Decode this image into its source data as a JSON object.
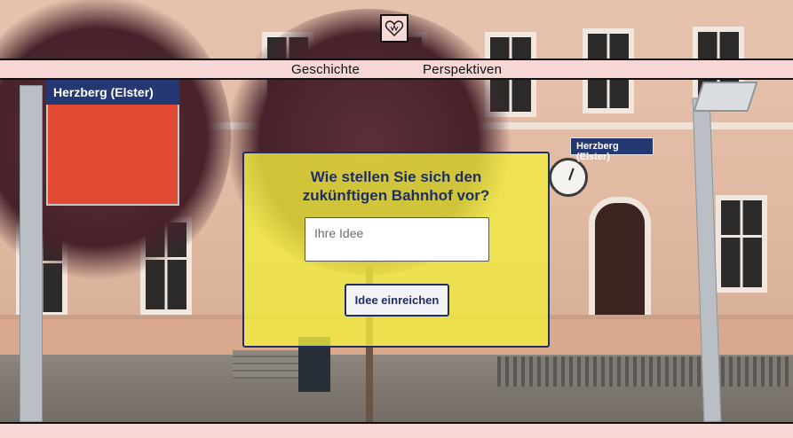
{
  "header": {
    "logo_icon": "heart-logo-icon",
    "nav": [
      {
        "label": "Geschichte"
      },
      {
        "label": "Perspektiven"
      }
    ]
  },
  "background": {
    "station_sign_large": "Herzberg (Elster)",
    "station_sign_small": "Herzberg (Elster)"
  },
  "form": {
    "title": "Wie stellen Sie sich den zukünftigen Bahnhof vor?",
    "input_placeholder": "Ihre Idee",
    "input_value": "",
    "submit_label": "Idee einreichen"
  },
  "colors": {
    "nav_background": "#f7d7d5",
    "panel_background": "#f1ec3e",
    "accent_navy": "#1f2f63"
  }
}
